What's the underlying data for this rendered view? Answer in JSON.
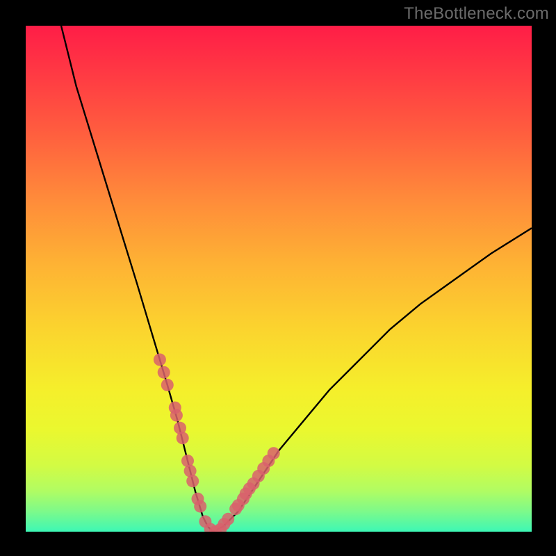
{
  "watermark": "TheBottleneck.com",
  "chart_data": {
    "type": "line",
    "title": "",
    "xlabel": "",
    "ylabel": "",
    "xlim": [
      0,
      100
    ],
    "ylim": [
      0,
      100
    ],
    "series": [
      {
        "name": "curve",
        "x": [
          7,
          10,
          14,
          18,
          22,
          25,
          28,
          30,
          32,
          33.5,
          35,
          36,
          37,
          39,
          42,
          46,
          50,
          55,
          60,
          66,
          72,
          78,
          85,
          92,
          100
        ],
        "y": [
          100,
          88,
          75,
          62,
          49,
          39,
          29,
          22,
          14,
          8,
          3,
          1,
          0,
          1,
          4,
          10,
          16,
          22,
          28,
          34,
          40,
          45,
          50,
          55,
          60
        ]
      }
    ],
    "markers": {
      "name": "highlight-dots",
      "color": "#d9606c",
      "points_x": [
        26.5,
        27.3,
        28.0,
        29.5,
        29.8,
        30.5,
        31.0,
        32.0,
        32.5,
        33.0,
        34.0,
        34.5,
        35.5,
        36.5,
        37.5,
        38.5,
        39.2,
        40.0,
        41.5,
        42.0,
        43.0,
        43.5,
        44.2,
        45.0,
        46.0,
        47.0,
        48.0,
        49.0
      ],
      "points_y": [
        34.0,
        31.5,
        29.0,
        24.5,
        23.0,
        20.5,
        18.5,
        14.0,
        12.0,
        10.0,
        6.5,
        5.0,
        2.0,
        0.5,
        0.0,
        0.5,
        1.5,
        2.5,
        4.5,
        5.2,
        6.5,
        7.5,
        8.5,
        9.5,
        11.0,
        12.5,
        14.0,
        15.5
      ]
    },
    "gradient_stops": [
      {
        "pos": 0,
        "color": "#ff1d47"
      },
      {
        "pos": 8,
        "color": "#ff3544"
      },
      {
        "pos": 20,
        "color": "#ff5a3f"
      },
      {
        "pos": 34,
        "color": "#ff8a3a"
      },
      {
        "pos": 47,
        "color": "#feb234"
      },
      {
        "pos": 60,
        "color": "#fbd42e"
      },
      {
        "pos": 72,
        "color": "#f5ef2b"
      },
      {
        "pos": 80,
        "color": "#eaf82f"
      },
      {
        "pos": 87,
        "color": "#d2fb44"
      },
      {
        "pos": 92,
        "color": "#b0fc63"
      },
      {
        "pos": 96,
        "color": "#7dfa8a"
      },
      {
        "pos": 100,
        "color": "#3df7b5"
      }
    ]
  }
}
